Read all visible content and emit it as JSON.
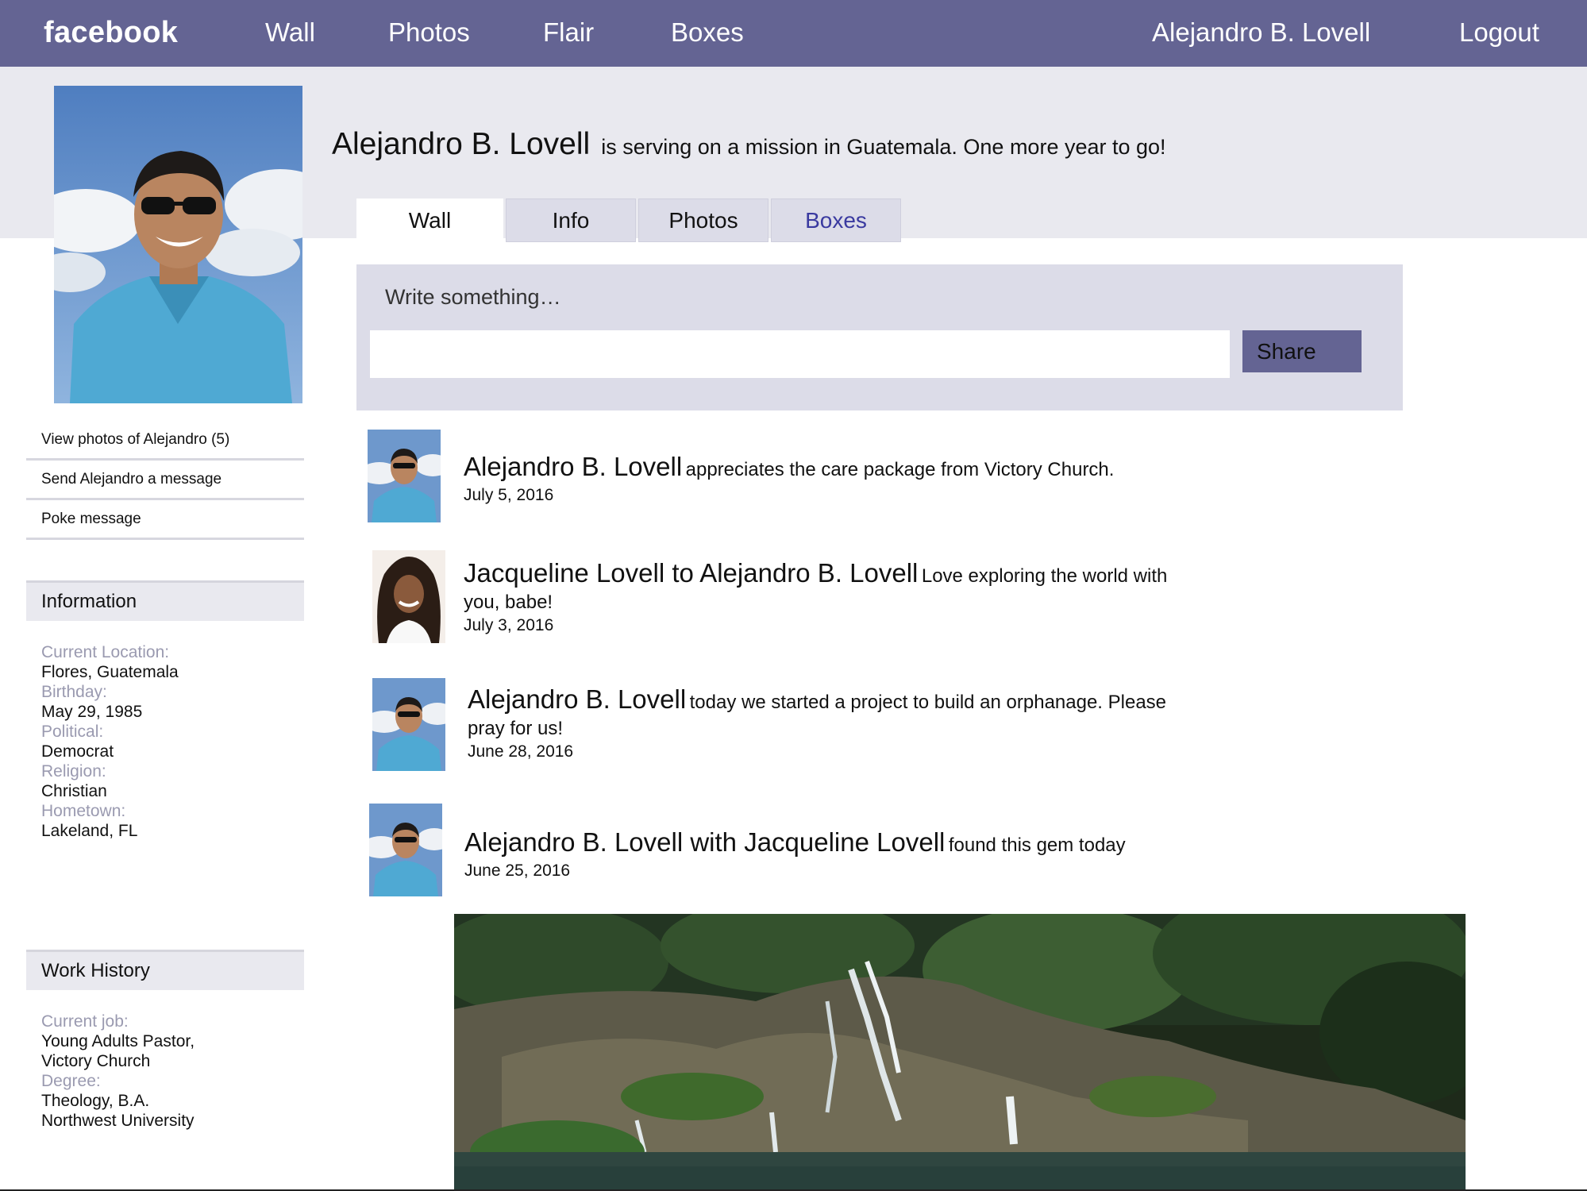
{
  "topbar": {
    "logo": "facebook",
    "nav": [
      "Wall",
      "Photos",
      "Flair",
      "Boxes"
    ],
    "user": "Alejandro B. Lovell",
    "logout": "Logout"
  },
  "profile": {
    "name": "Alejandro B. Lovell",
    "status": "is serving on a mission in Guatemala. One more year to go!"
  },
  "tabs": [
    "Wall",
    "Info",
    "Photos",
    "Boxes"
  ],
  "composer": {
    "prompt": "Write something…",
    "value": "",
    "share": "Share"
  },
  "side_links": [
    "View photos of Alejandro  (5)",
    "Send Alejandro  a message",
    "Poke message"
  ],
  "information": {
    "title": "Information",
    "items": [
      {
        "label": "Current Location:",
        "value": "Flores, Guatemala"
      },
      {
        "label": "Birthday:",
        "value": "May 29, 1985"
      },
      {
        "label": "Political:",
        "value": "Democrat"
      },
      {
        "label": "Religion:",
        "value": "Christian"
      },
      {
        "label": "Hometown:",
        "value": "Lakeland, FL"
      }
    ]
  },
  "work": {
    "title": "Work History",
    "current_job_label": "Current job:",
    "current_job_1": "Young Adults Pastor,",
    "current_job_2": "Victory Church",
    "degree_label": "Degree:",
    "degree_1": "Theology, B.A.",
    "degree_2": "Northwest University"
  },
  "posts": [
    {
      "author": "Alejandro B. Lovell",
      "message": "appreciates the care package from Victory Church.",
      "date": "July 5, 2016"
    },
    {
      "author": "Jacqueline Lovell to Alejandro B. Lovell",
      "message": "Love exploring the world with",
      "message_2": "you, babe!",
      "date": "July 3, 2016"
    },
    {
      "author": "Alejandro B. Lovell",
      "message": "today we started a project to build an orphanage. Please",
      "message_2": "pray for us!",
      "date": "June 28, 2016"
    },
    {
      "author": "Alejandro B. Lovell with Jacqueline Lovell",
      "message": "found this gem today",
      "date": "June 25, 2016"
    }
  ],
  "colors": {
    "topbar": "#646493",
    "band": "#e9e9ef",
    "composer": "#dcdce8",
    "label_grey": "#9a9ab0",
    "boxes_tab": "#3a3aa0"
  }
}
